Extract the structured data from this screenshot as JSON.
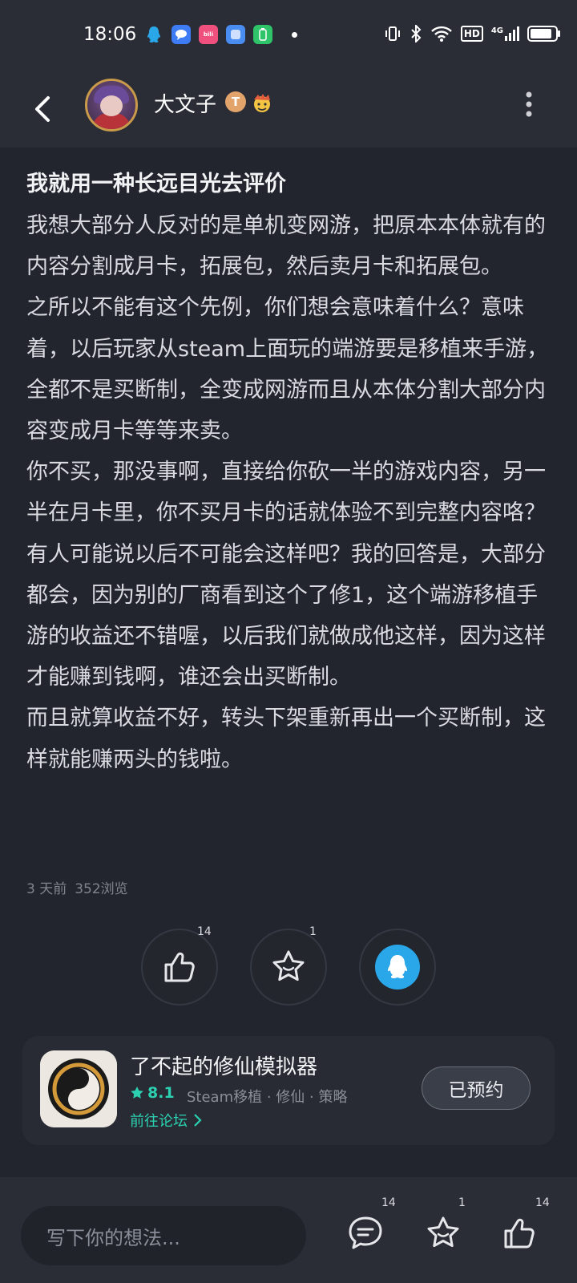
{
  "status_bar": {
    "time": "18:06",
    "notification_icons": [
      "qq-icon",
      "chat-bubble-icon",
      "bilibili-icon",
      "app-icon",
      "battery-app-icon"
    ],
    "network": "4G",
    "hd_label": "HD"
  },
  "header": {
    "username": "大文子",
    "badge_letter": "T"
  },
  "post": {
    "title": "我就用一种长远目光去评价",
    "paragraphs": [
      "我想大部分人反对的是单机变网游，把原本本体就有的内容分割成月卡，拓展包，然后卖月卡和拓展包。",
      "之所以不能有这个先例，你们想会意味着什么？意味着，以后玩家从steam上面玩的端游要是移植来手游，全都不是买断制，全变成网游而且从本体分割大部分内容变成月卡等等来卖。",
      "你不买，那没事啊，直接给你砍一半的游戏内容，另一半在月卡里，你不买月卡的话就体验不到完整内容咯？有人可能说以后不可能会这样吧？我的回答是，大部分都会，因为别的厂商看到这个了修1，这个端游移植手游的收益还不错喔，以后我们就做成他这样，因为这样才能赚到钱啊，谁还会出买断制。",
      "而且就算收益不好，转头下架重新再出一个买断制，这样就能赚两头的钱啦。"
    ],
    "time_ago": "3 天前",
    "views": "352浏览"
  },
  "actions": {
    "like_count": "14",
    "favorite_count": "1"
  },
  "game": {
    "title": "了不起的修仙模拟器",
    "rating": "8.1",
    "tags": "Steam移植 · 修仙 · 策略",
    "forum_link": "前往论坛",
    "reserve_label": "已预约"
  },
  "bottom": {
    "input_placeholder": "写下你的想法...",
    "comment_count": "14",
    "favorite_count": "1",
    "like_count": "14"
  },
  "colors": {
    "background": "#22252e",
    "accent_teal": "#2bd1b0",
    "qq_blue": "#2aa7e8"
  }
}
